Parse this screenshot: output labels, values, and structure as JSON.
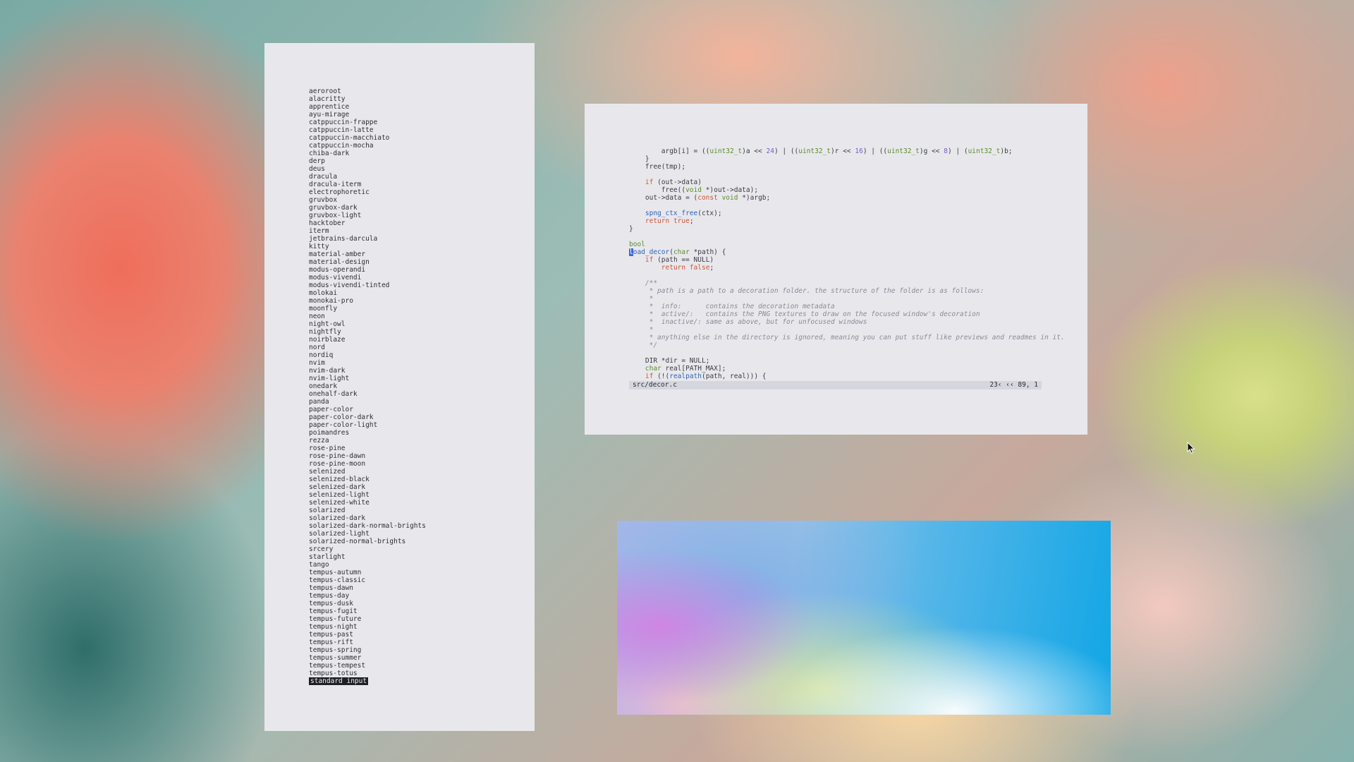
{
  "themes": [
    "aeroroot",
    "alacritty",
    "apprentice",
    "ayu-mirage",
    "catppuccin-frappe",
    "catppuccin-latte",
    "catppuccin-macchiato",
    "catppuccin-mocha",
    "chiba-dark",
    "derp",
    "deus",
    "dracula",
    "dracula-iterm",
    "electrophoretic",
    "gruvbox",
    "gruvbox-dark",
    "gruvbox-light",
    "hacktober",
    "iterm",
    "jetbrains-darcula",
    "kitty",
    "material-amber",
    "material-design",
    "modus-operandi",
    "modus-vivendi",
    "modus-vivendi-tinted",
    "molokai",
    "monokai-pro",
    "moonfly",
    "neon",
    "night-owl",
    "nightfly",
    "noirblaze",
    "nord",
    "nordiq",
    "nvim",
    "nvim-dark",
    "nvim-light",
    "onedark",
    "onehalf-dark",
    "panda",
    "paper-color",
    "paper-color-dark",
    "paper-color-light",
    "poimandres",
    "rezza",
    "rose-pine",
    "rose-pine-dawn",
    "rose-pine-moon",
    "selenized",
    "selenized-black",
    "selenized-dark",
    "selenized-light",
    "selenized-white",
    "solarized",
    "solarized-dark",
    "solarized-dark-normal-brights",
    "solarized-light",
    "solarized-normal-brights",
    "srcery",
    "starlight",
    "tango",
    "tempus-autumn",
    "tempus-classic",
    "tempus-dawn",
    "tempus-day",
    "tempus-dusk",
    "tempus-fugit",
    "tempus-future",
    "tempus-night",
    "tempus-past",
    "tempus-rift",
    "tempus-spring",
    "tempus-summer",
    "tempus-tempest",
    "tempus-totus"
  ],
  "prompt": "standard input",
  "code_lines": [
    [
      [
        "        argb[i] = ((",
        ""
      ],
      [
        "uint32_t",
        "ty"
      ],
      [
        ")a << ",
        ""
      ],
      [
        "24",
        "num"
      ],
      [
        ") | ((",
        ""
      ],
      [
        "uint32_t",
        "ty"
      ],
      [
        ")r << ",
        ""
      ],
      [
        "16",
        "num"
      ],
      [
        ") | ((",
        ""
      ],
      [
        "uint32_t",
        "ty"
      ],
      [
        ")g << ",
        ""
      ],
      [
        "8",
        "num"
      ],
      [
        ") | (",
        ""
      ],
      [
        "uint32_t",
        "ty"
      ],
      [
        ")b;",
        ""
      ]
    ],
    [
      [
        "    }",
        ""
      ]
    ],
    [
      [
        "    free(tmp);",
        ""
      ]
    ],
    [
      [
        "",
        ""
      ]
    ],
    [
      [
        "    ",
        ""
      ],
      [
        "if",
        "kw"
      ],
      [
        " (out->data)",
        ""
      ]
    ],
    [
      [
        "        free((",
        ""
      ],
      [
        "void",
        "ty"
      ],
      [
        " *)out->data);",
        ""
      ]
    ],
    [
      [
        "    out->data = (",
        ""
      ],
      [
        "const",
        "kw"
      ],
      [
        " ",
        ""
      ],
      [
        "void",
        "ty"
      ],
      [
        " *)argb;",
        ""
      ]
    ],
    [
      [
        "",
        ""
      ]
    ],
    [
      [
        "    ",
        ""
      ],
      [
        "spng_ctx_free",
        "fn"
      ],
      [
        "(ctx);",
        ""
      ]
    ],
    [
      [
        "    ",
        ""
      ],
      [
        "return",
        "kw"
      ],
      [
        " ",
        ""
      ],
      [
        "true",
        "kw"
      ],
      [
        ";",
        ""
      ]
    ],
    [
      [
        "}",
        ""
      ]
    ],
    [
      [
        "",
        ""
      ]
    ],
    [
      [
        "bool",
        "ty"
      ]
    ],
    [
      [
        "l",
        "cur"
      ],
      [
        "oad_decor",
        "fn"
      ],
      [
        "(",
        ""
      ],
      [
        "char",
        "ty"
      ],
      [
        " *path) {",
        ""
      ]
    ],
    [
      [
        "    ",
        ""
      ],
      [
        "if",
        "kw"
      ],
      [
        " (path == NULL)",
        ""
      ]
    ],
    [
      [
        "        ",
        ""
      ],
      [
        "return",
        "kw"
      ],
      [
        " ",
        ""
      ],
      [
        "false",
        "kw"
      ],
      [
        ";",
        ""
      ]
    ],
    [
      [
        "",
        ""
      ]
    ],
    [
      [
        "    /**",
        "cm"
      ]
    ],
    [
      [
        "     * path is a path to a decoration folder. the structure of the folder is as follows:",
        "cm"
      ]
    ],
    [
      [
        "     *",
        "cm"
      ]
    ],
    [
      [
        "     *  info:      contains the decoration metadata",
        "cm"
      ]
    ],
    [
      [
        "     *  active/:   contains the PNG textures to draw on the focused window's decoration",
        "cm"
      ]
    ],
    [
      [
        "     *  inactive/: same as above, but for unfocused windows",
        "cm"
      ]
    ],
    [
      [
        "     *",
        "cm"
      ]
    ],
    [
      [
        "     * anything else in the directory is ignored, meaning you can put stuff like previews and readmes in it.",
        "cm"
      ]
    ],
    [
      [
        "     */",
        "cm"
      ]
    ],
    [
      [
        "",
        ""
      ]
    ],
    [
      [
        "    DIR *dir = NULL;",
        ""
      ]
    ],
    [
      [
        "    ",
        ""
      ],
      [
        "char",
        "ty"
      ],
      [
        " real[PATH_MAX];",
        ""
      ]
    ],
    [
      [
        "    ",
        ""
      ],
      [
        "if",
        "kw"
      ],
      [
        " (!(",
        ""
      ],
      [
        "realpath",
        "fn"
      ],
      [
        "(path, real))) {",
        ""
      ]
    ]
  ],
  "statusline": {
    "file": "src/decor.c",
    "position": "23‹ ‹‹ 89, 1"
  }
}
